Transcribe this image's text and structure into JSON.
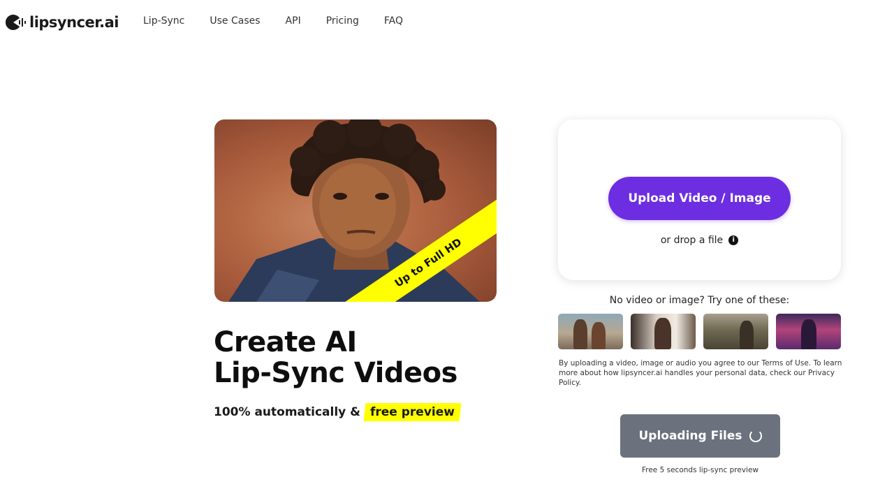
{
  "header": {
    "logo_text": "lipsyncer.ai",
    "nav": [
      "Lip-Sync",
      "Use Cases",
      "API",
      "Pricing",
      "FAQ"
    ]
  },
  "hero": {
    "ribbon_text": "Up to Full HD",
    "headline_line1": "Create AI",
    "headline_line2": "Lip-Sync Videos",
    "sub_prefix": "100% automatically &",
    "sub_highlight": "free preview"
  },
  "upload": {
    "button_label": "Upload Video / Image",
    "drop_text": "or drop a file",
    "info_icon": "i",
    "try_text": "No video or image? Try one of these:",
    "samples": [
      "sample-couple",
      "sample-cafe-woman",
      "sample-landscape-man",
      "sample-neon-city"
    ],
    "terms_text": "By uploading a video, image or audio you agree to our Terms of Use. To learn more about how lipsyncer.ai handles your personal data, check our Privacy Policy.",
    "uploading_label": "Uploading Files",
    "free_preview_text": "Free 5 seconds lip-sync preview"
  },
  "colors": {
    "accent": "#6c2ee0",
    "highlight": "#ffff00",
    "uploading_bg": "#6b727d"
  }
}
